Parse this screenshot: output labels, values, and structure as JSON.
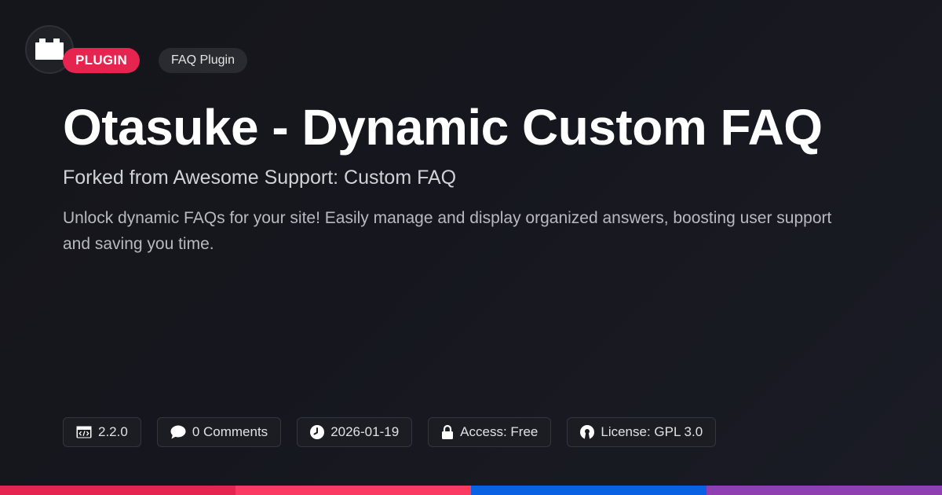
{
  "logo": {
    "icon": "plugin-block-icon"
  },
  "badges": {
    "type": "PLUGIN",
    "category": "FAQ Plugin"
  },
  "title": "Otasuke - Dynamic Custom FAQ",
  "subtitle": "Forked from Awesome Support: Custom FAQ",
  "description": "Unlock dynamic FAQs for your site! Easily manage and display organized answers, boosting user support and saving you time.",
  "meta": {
    "version": {
      "icon": "code-icon",
      "label": "2.2.0"
    },
    "comments": {
      "icon": "comment-icon",
      "label": "0 Comments"
    },
    "date": {
      "icon": "clock-icon",
      "label": "2026-01-19"
    },
    "access": {
      "icon": "lock-icon",
      "label": "Access: Free"
    },
    "license": {
      "icon": "open-source-icon",
      "label": "License: GPL 3.0"
    }
  },
  "colors": {
    "accent": "#e5244f",
    "bar": [
      "#e5244f",
      "#fb3a63",
      "#0b61e4",
      "#8f3fb0"
    ]
  }
}
